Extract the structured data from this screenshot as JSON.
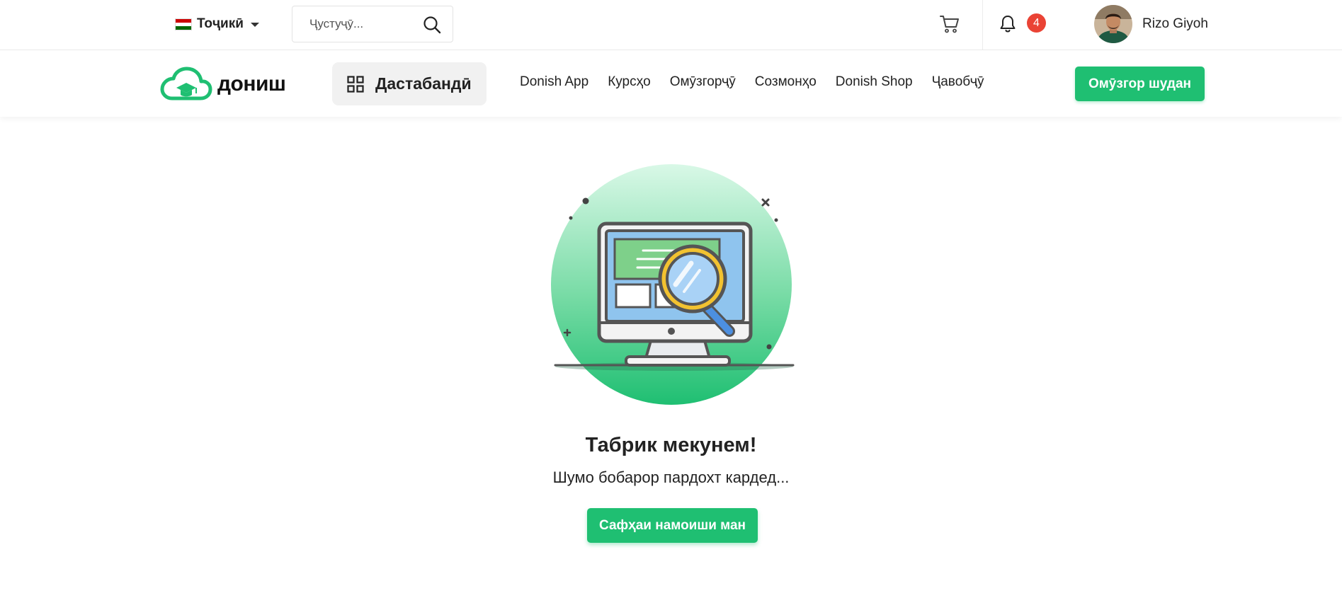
{
  "topbar": {
    "language": {
      "label": "Тоҷикӣ",
      "flag_colors": [
        "#cc0000",
        "#ffffff",
        "#006600"
      ]
    },
    "search": {
      "placeholder": "Ҷустуҷӯ..."
    },
    "notifications": {
      "count": "4"
    },
    "user": {
      "name": "Rizo Giyoh"
    }
  },
  "navbar": {
    "logo_text": "дониш",
    "categories_label": "Дастабандӣ",
    "links": [
      "Donish App",
      "Курсҳо",
      "Омӯзгорҷӯ",
      "Созмонҳо",
      "Donish Shop",
      "Ҷавобҷӯ"
    ],
    "cta_label": "Омӯзгор шудан"
  },
  "main": {
    "title": "Табрик мекунем!",
    "subtitle": "Шумо бобарор пардохт кардед...",
    "button_label": "Сафҳаи намоиши ман"
  },
  "colors": {
    "accent": "#1fbf72",
    "badge": "#ea4335"
  }
}
